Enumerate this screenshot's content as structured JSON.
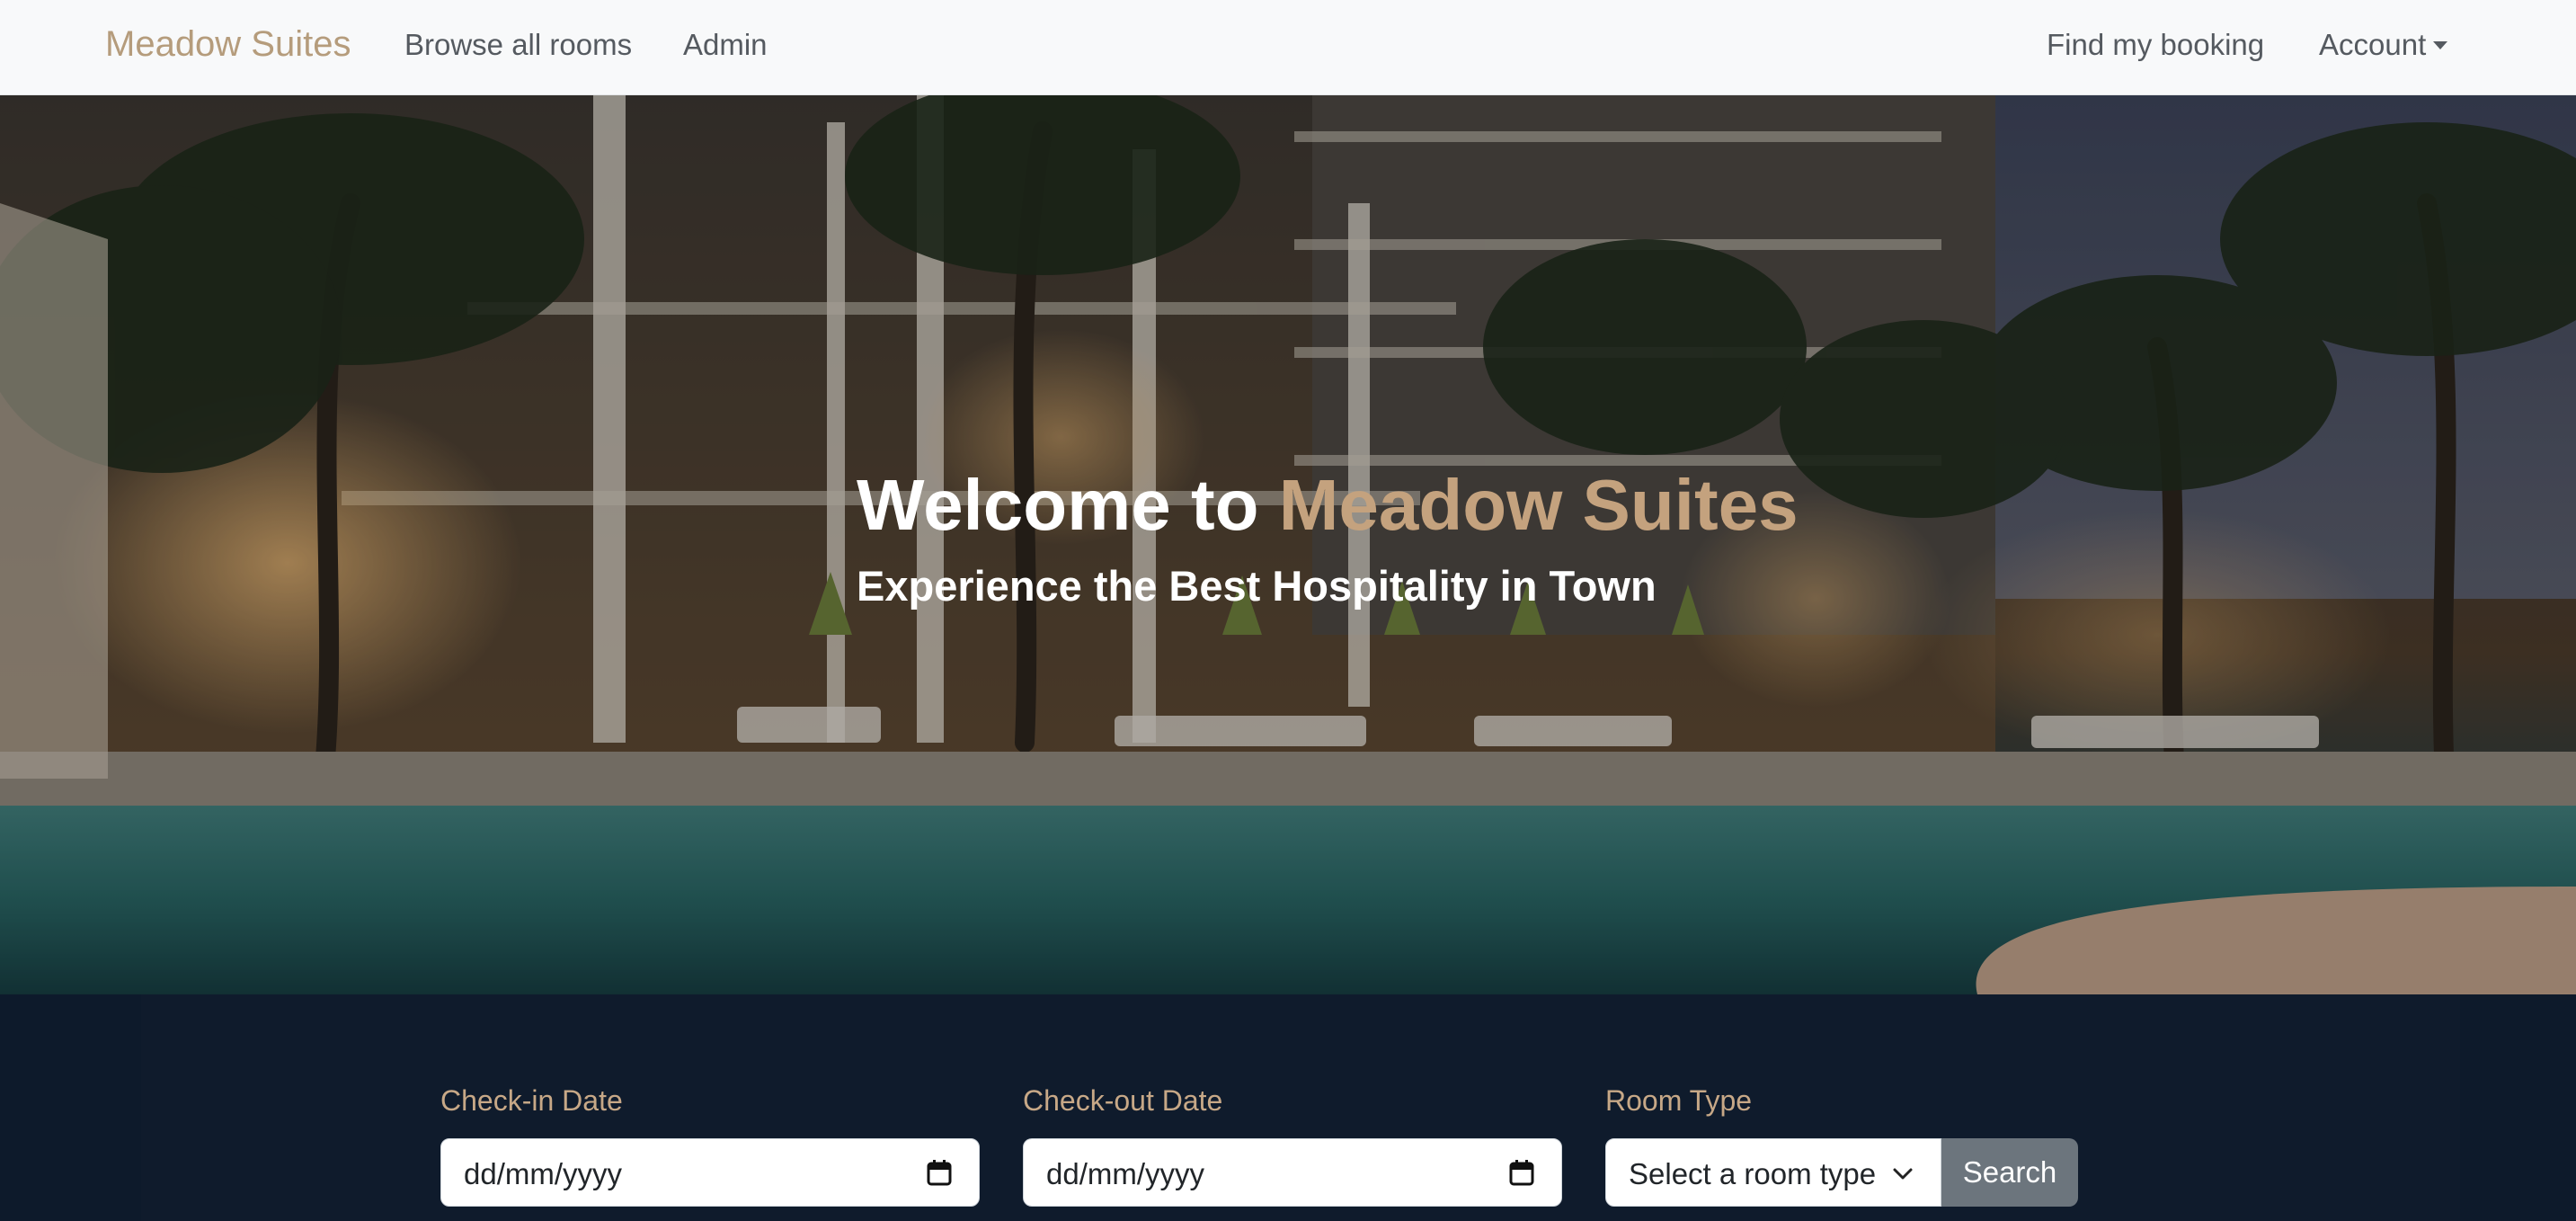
{
  "navbar": {
    "brand": "Meadow Suites",
    "links": {
      "browse": "Browse all rooms",
      "admin": "Admin",
      "find_booking": "Find my booking",
      "account": "Account"
    }
  },
  "hero": {
    "title_prefix": "Welcome to ",
    "title_accent": "Meadow Suites",
    "subtitle": "Experience the Best Hospitality in Town"
  },
  "search": {
    "checkin_label": "Check-in Date",
    "checkin_placeholder": "dd/mm/yyyy",
    "checkout_label": "Check-out Date",
    "checkout_placeholder": "dd/mm/yyyy",
    "room_type_label": "Room Type",
    "room_type_selected": "Select a room type",
    "search_button": "Search"
  },
  "colors": {
    "brand": "#b59c7c",
    "accent": "#c4a27e",
    "navbar_bg": "#f8f9fa",
    "section_bg": "#0d1a2b",
    "button_bg": "#6c757d"
  },
  "icons": [
    "calendar-icon",
    "chevron-down-icon",
    "caret-down-icon"
  ]
}
